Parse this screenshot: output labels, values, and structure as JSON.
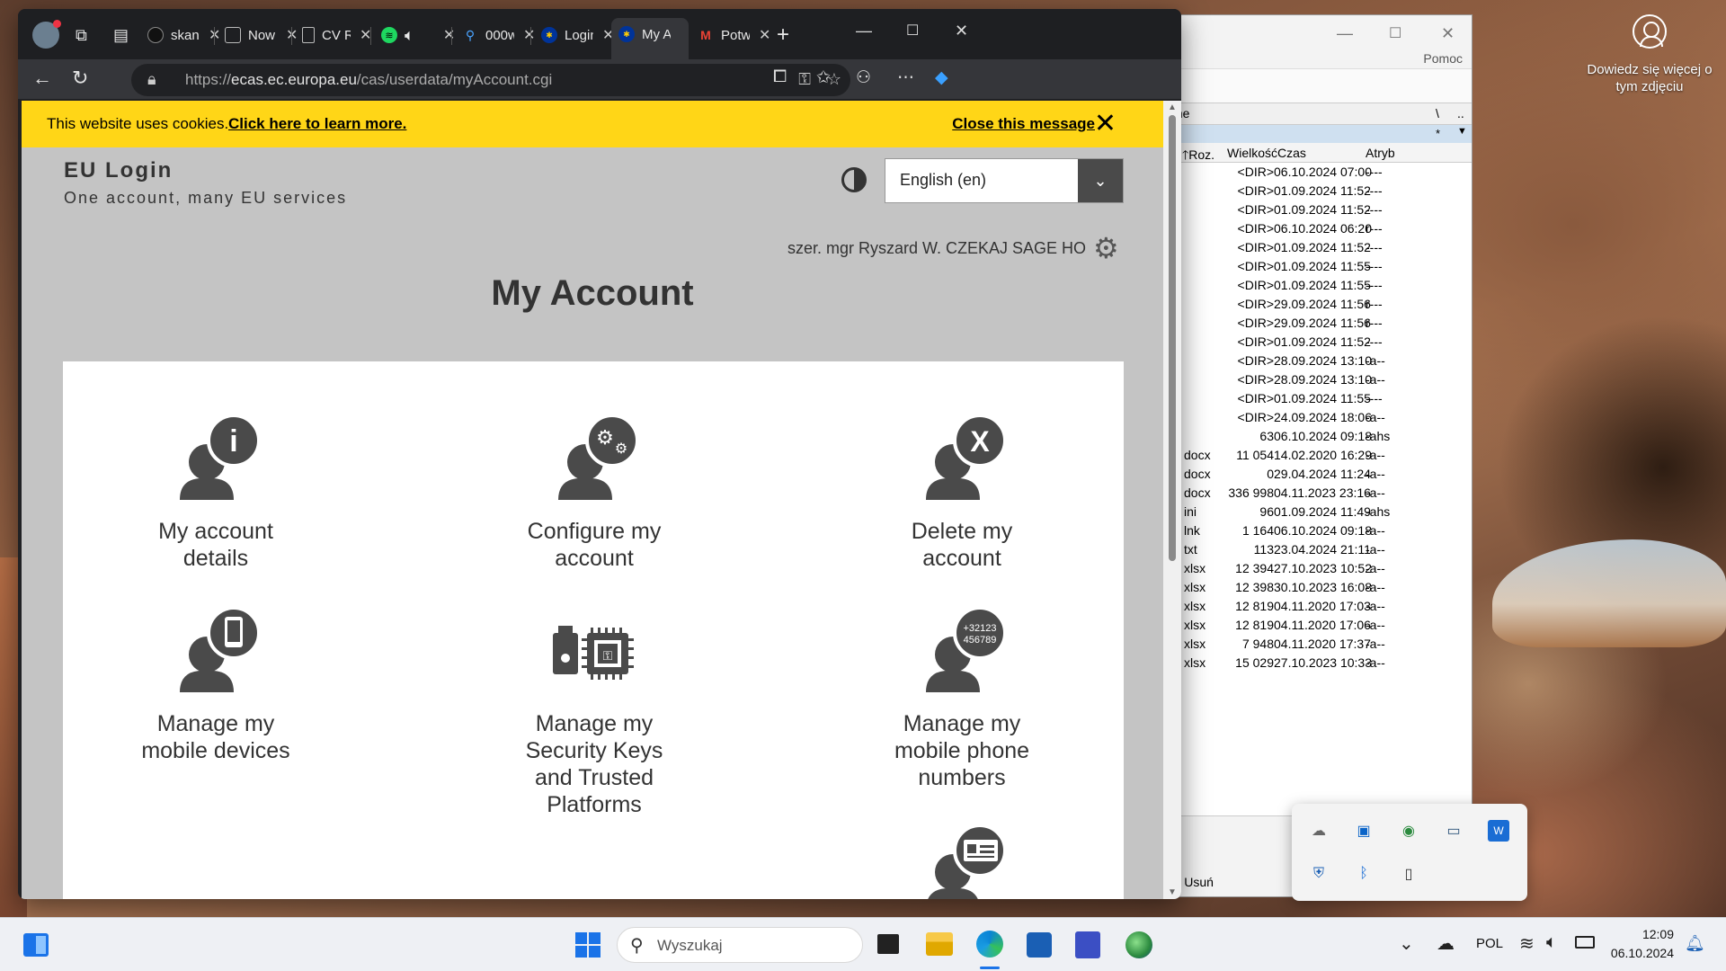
{
  "desktop": {
    "info_text": "Dowiedz się więcej o tym zdjęciu"
  },
  "file_manager": {
    "menu_help": "Pomoc",
    "path_fragment": "olne",
    "path_right_1": "\\",
    "path_right_2": "..",
    "filter_1": "*",
    "filter_2": "▼",
    "headers": {
      "ext": "Roz.",
      "size": "Wielkość",
      "time": "Czas",
      "attr": "Atryb"
    },
    "rows": [
      {
        "ext": "",
        "size": "<DIR>",
        "time": "06.10.2024 07:00",
        "attr": "----"
      },
      {
        "ext": "",
        "size": "<DIR>",
        "time": "01.09.2024 11:52",
        "attr": "----"
      },
      {
        "ext": "",
        "size": "<DIR>",
        "time": "01.09.2024 11:52",
        "attr": "----"
      },
      {
        "ext": "",
        "size": "<DIR>",
        "time": "06.10.2024 06:20",
        "attr": "r---"
      },
      {
        "ext": "",
        "size": "<DIR>",
        "time": "01.09.2024 11:52",
        "attr": "----"
      },
      {
        "ext": "",
        "size": "<DIR>",
        "time": "01.09.2024 11:55",
        "attr": "----"
      },
      {
        "ext": "",
        "size": "<DIR>",
        "time": "01.09.2024 11:55",
        "attr": "----"
      },
      {
        "ext": "",
        "size": "<DIR>",
        "time": "29.09.2024 11:56",
        "attr": "r---"
      },
      {
        "ext": "",
        "size": "<DIR>",
        "time": "29.09.2024 11:56",
        "attr": "r---"
      },
      {
        "ext": "",
        "size": "<DIR>",
        "time": "01.09.2024 11:52",
        "attr": "----"
      },
      {
        "ext": "",
        "size": "<DIR>",
        "time": "28.09.2024 13:10",
        "attr": "-a--"
      },
      {
        "ext": "",
        "size": "<DIR>",
        "time": "28.09.2024 13:10",
        "attr": "-a--"
      },
      {
        "ext": "",
        "size": "<DIR>",
        "time": "01.09.2024 11:55",
        "attr": "----"
      },
      {
        "ext": "",
        "size": "<DIR>",
        "time": "24.09.2024 18:06",
        "attr": "-a--"
      },
      {
        "ext": "",
        "size": "63",
        "time": "06.10.2024 09:18",
        "attr": "-ahs"
      },
      {
        "ext": "docx",
        "size": "11 054",
        "time": "14.02.2020 16:29",
        "attr": "-a--"
      },
      {
        "ext": "docx",
        "size": "0",
        "time": "29.04.2024 11:24",
        "attr": "-a--"
      },
      {
        "ext": "docx",
        "size": "336 998",
        "time": "04.11.2023 23:16",
        "attr": "-a--"
      },
      {
        "ext": "ini",
        "size": "96",
        "time": "01.09.2024 11:49",
        "attr": "-ahs"
      },
      {
        "ext": "lnk",
        "size": "1 164",
        "time": "06.10.2024 09:18",
        "attr": "-a--"
      },
      {
        "ext": "txt",
        "size": "113",
        "time": "23.04.2024 21:11",
        "attr": "-a--"
      },
      {
        "ext": "xlsx",
        "size": "12 394",
        "time": "27.10.2023 10:52",
        "attr": "-a--"
      },
      {
        "ext": "xlsx",
        "size": "12 398",
        "time": "30.10.2023 16:08",
        "attr": "-a--"
      },
      {
        "ext": "xlsx",
        "size": "12 819",
        "time": "04.11.2020 17:03",
        "attr": "-a--"
      },
      {
        "ext": "xlsx",
        "size": "12 819",
        "time": "04.11.2020 17:06",
        "attr": "-a--"
      },
      {
        "ext": "xlsx",
        "size": "7 948",
        "time": "04.11.2020 17:37",
        "attr": "-a--"
      },
      {
        "ext": "xlsx",
        "size": "15 029",
        "time": "27.10.2023 10:33",
        "attr": "-a--"
      }
    ],
    "f8_label": "F8 Usuń"
  },
  "browser": {
    "tabs": [
      {
        "label": "skan",
        "favicon": "github-icon"
      },
      {
        "label": "Now",
        "favicon": "page-icon"
      },
      {
        "label": "CV R",
        "favicon": "document-icon"
      },
      {
        "label": "",
        "favicon": "spotify-icon"
      },
      {
        "label": "000w",
        "favicon": "search-icon"
      },
      {
        "label": "Login",
        "favicon": "eu-icon"
      },
      {
        "label": "My A",
        "favicon": "eu-icon"
      },
      {
        "label": "Potw",
        "favicon": "gmail-icon"
      }
    ],
    "url_prefix": "https://",
    "url_host": "ecas.ec.europa.eu",
    "url_path": "/cas/userdata/myAccount.cgi"
  },
  "cookie_banner": {
    "text": "This website uses cookies.",
    "learn_more": "Click here to learn more.",
    "close": "Close this message"
  },
  "eu_login": {
    "title": "EU Login",
    "subtitle": "One account, many EU services",
    "language": "English (en)",
    "user": "szer. mgr Ryszard W. CZEKAJ SAGE HO",
    "page_title": "My Account",
    "tiles": [
      {
        "label": "My account details"
      },
      {
        "label": "Configure my account"
      },
      {
        "label": "Delete my account"
      },
      {
        "label": "Manage my mobile devices"
      },
      {
        "label": "Manage my Security Keys and Trusted Platforms"
      },
      {
        "label": "Manage my mobile phone numbers"
      }
    ],
    "phone_badge": "+32123 456789"
  },
  "taskbar": {
    "search_placeholder": "Wyszukaj",
    "language": "POL",
    "time": "12:09",
    "date": "06.10.2024"
  },
  "colors": {
    "cookie_yellow": "#ffd617",
    "page_gray": "#c4c4c4",
    "icon_gray": "#4a4a4a"
  }
}
